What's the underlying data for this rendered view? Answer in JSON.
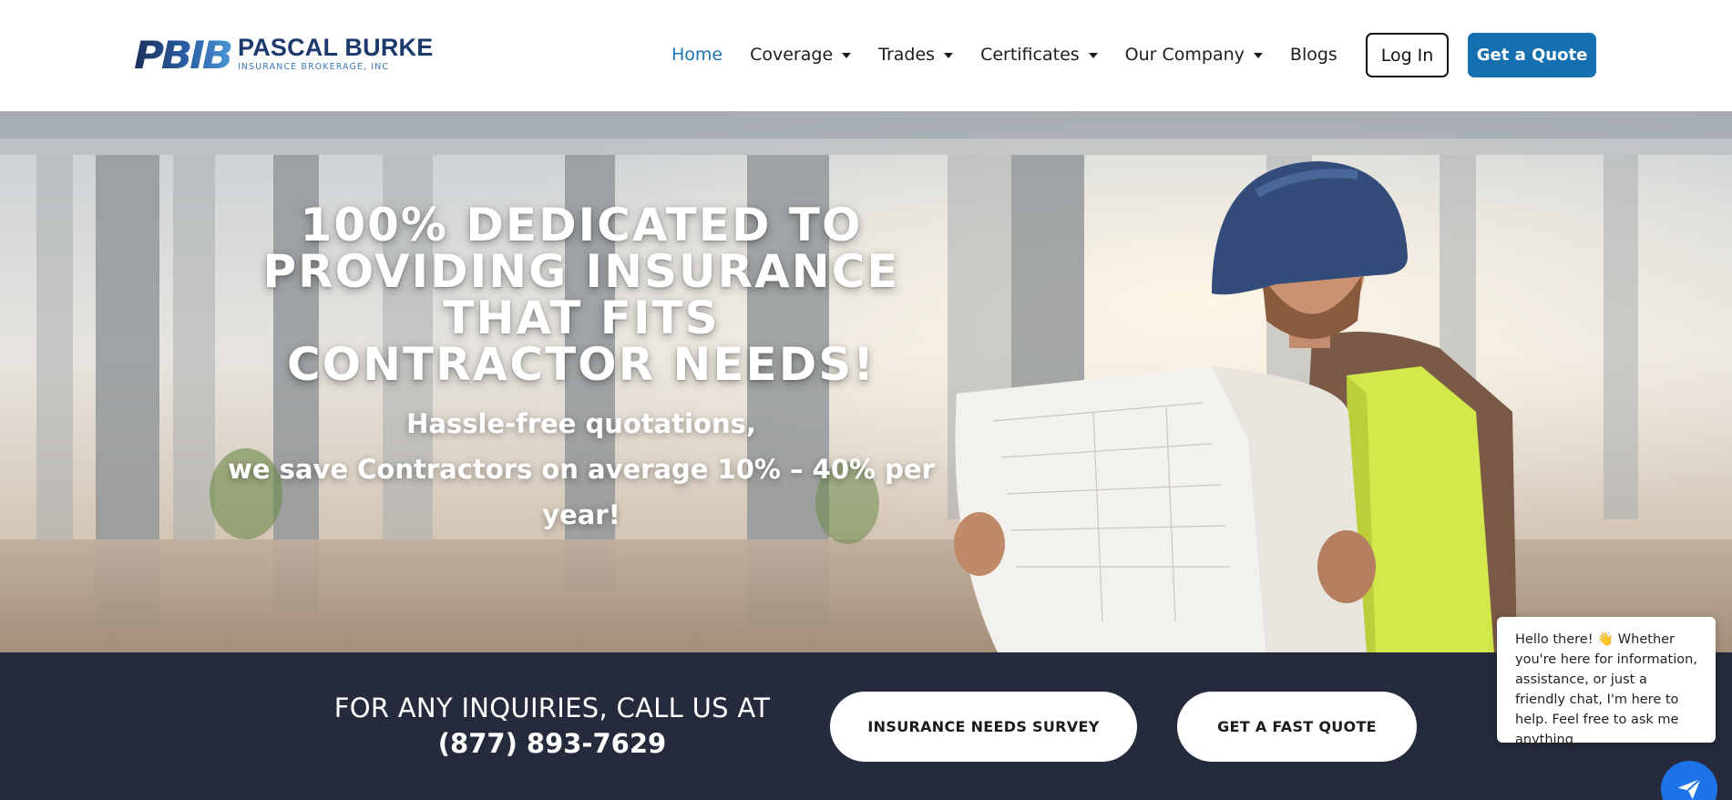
{
  "brand": {
    "logo_mark_text": "PBIB",
    "title": "PASCAL BURKE",
    "subtitle": "INSURANCE BROKERAGE, INC"
  },
  "nav": {
    "items": [
      {
        "label": "Home",
        "active": true,
        "dropdown": false
      },
      {
        "label": "Coverage",
        "active": false,
        "dropdown": true
      },
      {
        "label": "Trades",
        "active": false,
        "dropdown": true
      },
      {
        "label": "Certificates",
        "active": false,
        "dropdown": true
      },
      {
        "label": "Our Company",
        "active": false,
        "dropdown": true
      },
      {
        "label": "Blogs",
        "active": false,
        "dropdown": false
      }
    ],
    "login_label": "Log In",
    "quote_label": "Get a Quote"
  },
  "hero": {
    "title_lines": [
      "100% DEDICATED TO",
      "PROVIDING INSURANCE",
      "THAT FITS",
      "CONTRACTOR NEEDS!"
    ],
    "subtitle_lines": [
      "Hassle-free quotations,",
      "we save Contractors on average 10% – 40% per",
      "year!"
    ]
  },
  "cta": {
    "call_label": "FOR ANY INQUIRIES, CALL US AT",
    "phone": "(877) 893-7629",
    "survey_label": "INSURANCE NEEDS SURVEY",
    "fast_quote_label": "GET A FAST QUOTE"
  },
  "chat": {
    "message": "Hello there! 👋 Whether you're here for information, assistance, or just a friendly chat, I'm here to help. Feel free to ask me anything"
  },
  "colors": {
    "accent": "#1670b0",
    "nav_active": "#1973b2",
    "cta_bar": "#252b3c",
    "chat_button": "#1d74e8",
    "logo_dark": "#1d3a6e"
  },
  "icons": {
    "dropdown": "chevron-down-icon",
    "chat": "paper-plane-icon"
  }
}
